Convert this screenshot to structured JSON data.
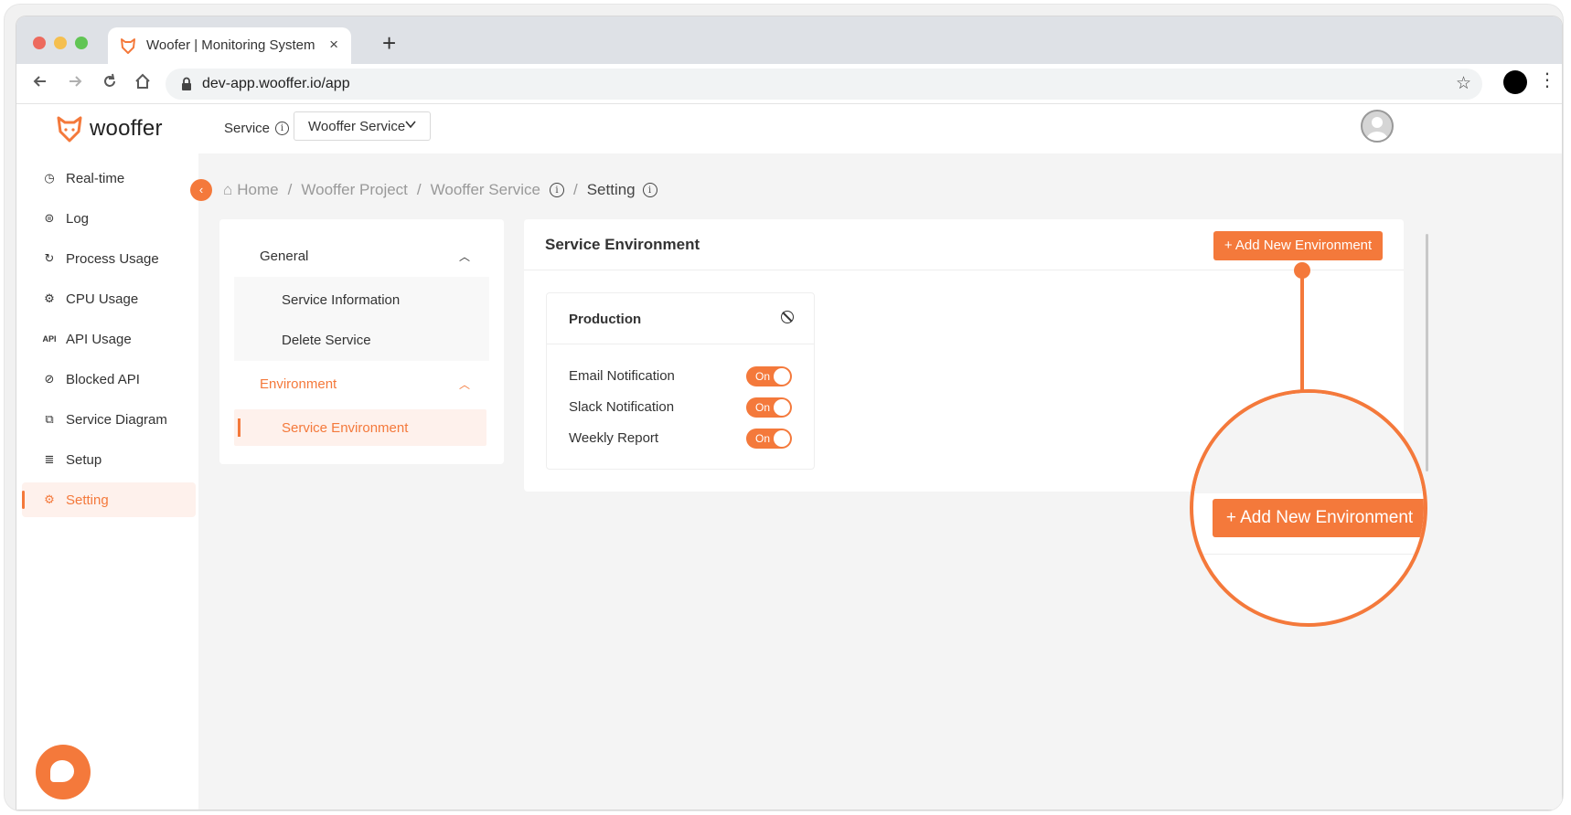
{
  "browser": {
    "tab_title": "Woofer | Monitoring System",
    "close_glyph": "×",
    "new_tab_glyph": "+",
    "url": "dev-app.wooffer.io/app"
  },
  "header": {
    "logo_text": "wooffer",
    "service_label": "Service",
    "service_value": "Wooffer Service"
  },
  "sidebar": {
    "items": [
      {
        "label": "Real-time",
        "icon": "gauge-icon"
      },
      {
        "label": "Log",
        "icon": "log-icon"
      },
      {
        "label": "Process Usage",
        "icon": "process-icon"
      },
      {
        "label": "CPU Usage",
        "icon": "cpu-icon"
      },
      {
        "label": "API Usage",
        "icon": "api-icon"
      },
      {
        "label": "Blocked API",
        "icon": "block-icon"
      },
      {
        "label": "Service Diagram",
        "icon": "diagram-icon"
      },
      {
        "label": "Setup",
        "icon": "database-icon"
      },
      {
        "label": "Setting",
        "icon": "gear-icon"
      }
    ]
  },
  "breadcrumb": {
    "home": "Home",
    "project": "Wooffer Project",
    "service": "Wooffer Service",
    "current": "Setting",
    "separator": "/"
  },
  "settings_menu": {
    "general": "General",
    "service_information": "Service Information",
    "delete_service": "Delete Service",
    "environment": "Environment",
    "service_environment": "Service Environment"
  },
  "env_panel": {
    "title": "Service Environment",
    "add_button": "+ Add New Environment",
    "card": {
      "name": "Production",
      "rows": [
        {
          "label": "Email Notification",
          "state": "On"
        },
        {
          "label": "Slack Notification",
          "state": "On"
        },
        {
          "label": "Weekly Report",
          "state": "On"
        }
      ]
    }
  },
  "callout": {
    "button_label": "+ Add New Environment"
  },
  "colors": {
    "accent": "#f4793b",
    "page_bg": "#f4f4f4"
  }
}
